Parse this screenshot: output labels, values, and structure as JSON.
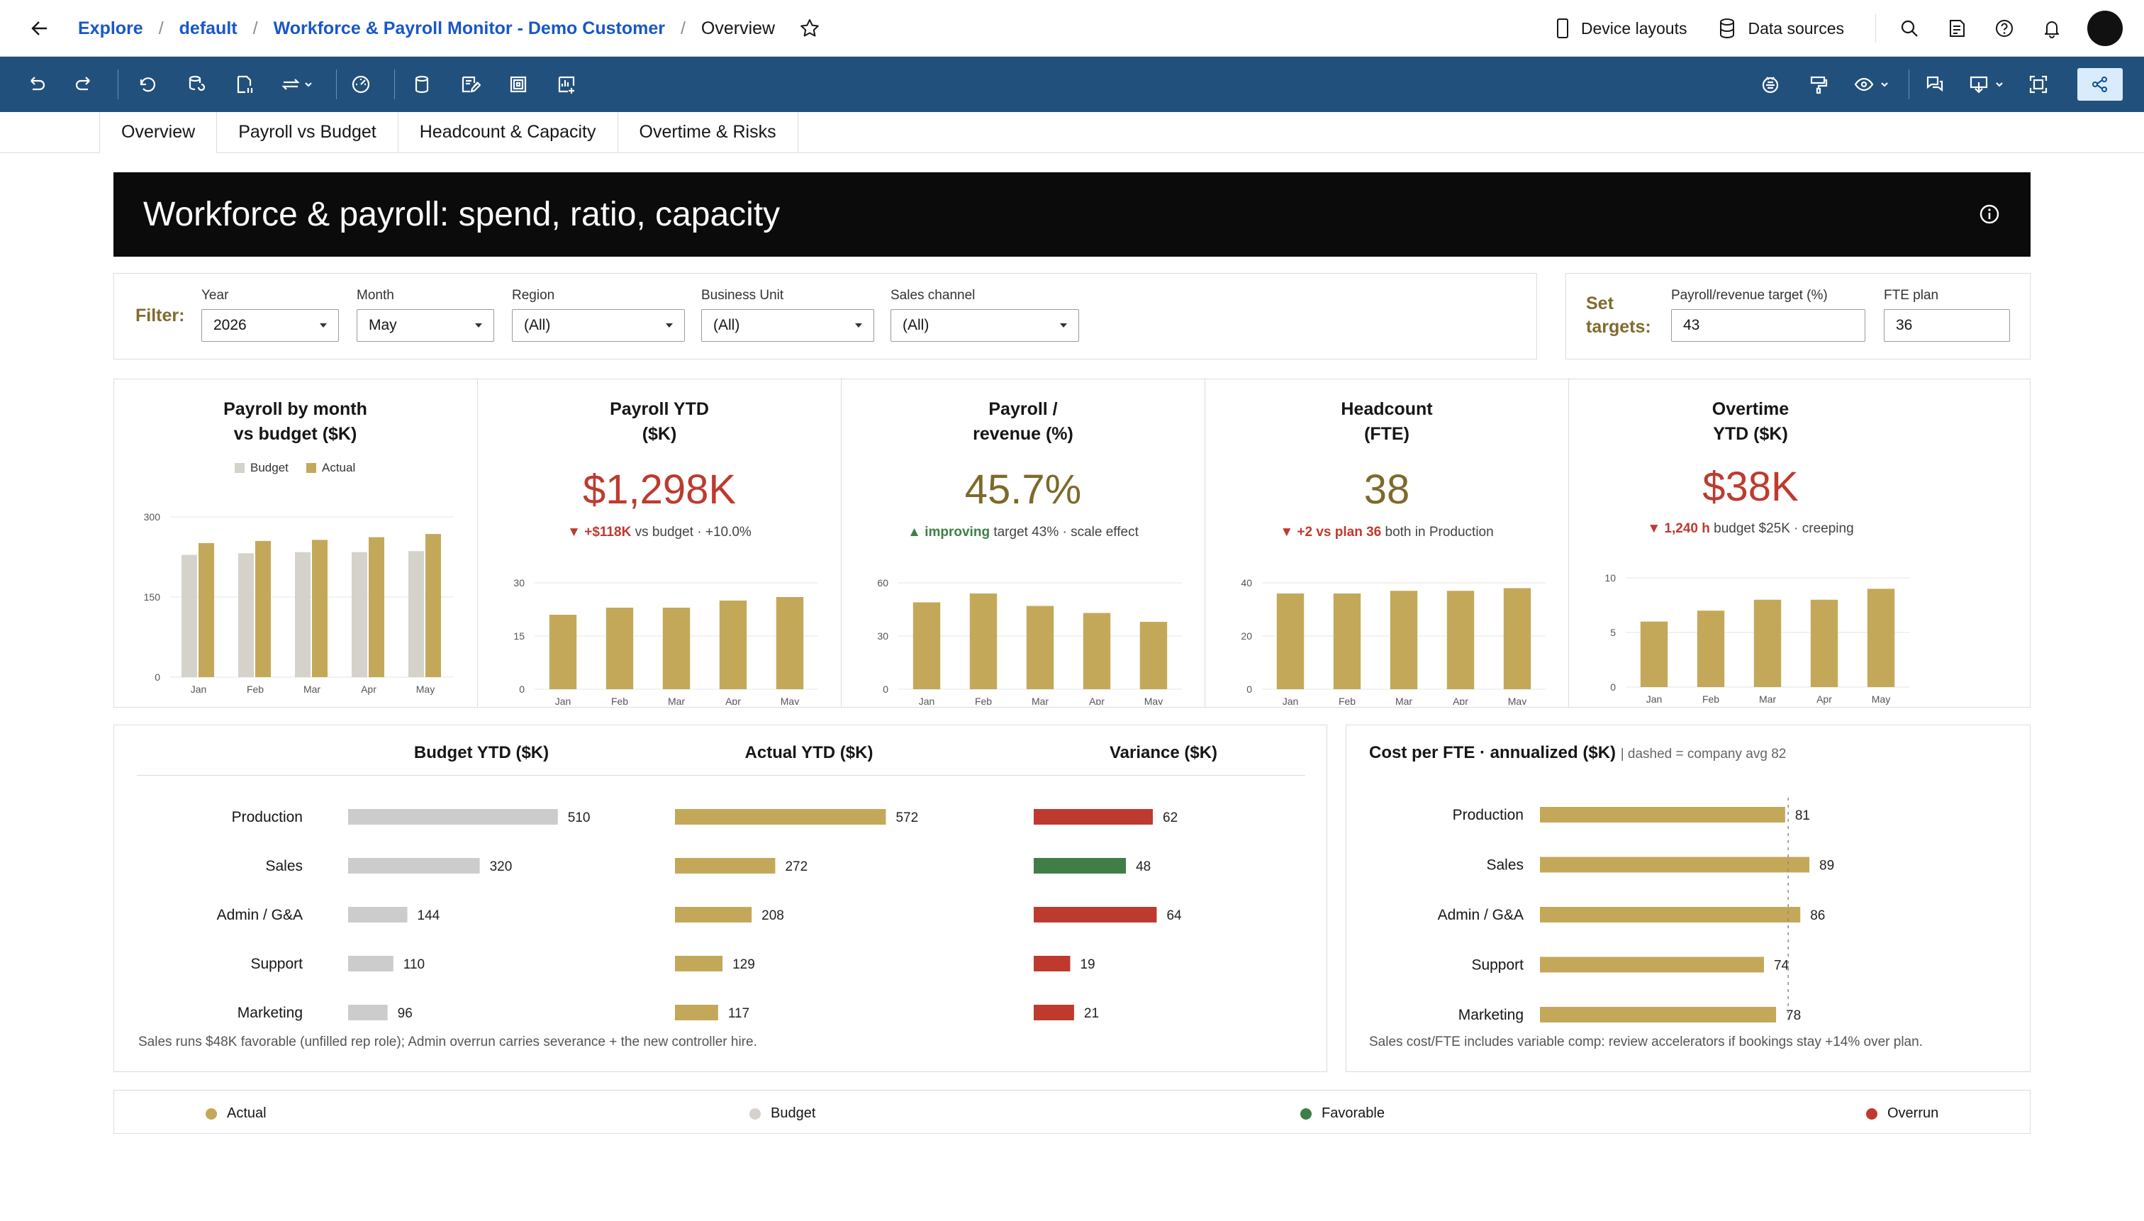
{
  "header": {
    "breadcrumbs": [
      "Explore",
      "default",
      "Workforce & Payroll Monitor - Demo Customer"
    ],
    "current": "Overview",
    "device_layouts": "Device layouts",
    "data_sources": "Data sources"
  },
  "tabs": [
    "Overview",
    "Payroll vs Budget",
    "Headcount & Capacity",
    "Overtime & Risks"
  ],
  "banner": {
    "title": "Workforce & payroll: spend, ratio, capacity"
  },
  "filters": {
    "label": "Filter:",
    "items": [
      {
        "label": "Year",
        "value": "2026"
      },
      {
        "label": "Month",
        "value": "May"
      },
      {
        "label": "Region",
        "value": "(All)"
      },
      {
        "label": "Business Unit",
        "value": "(All)"
      },
      {
        "label": "Sales channel",
        "value": "(All)"
      }
    ]
  },
  "targets": {
    "label_line1": "Set",
    "label_line2": "targets:",
    "items": [
      {
        "label": "Payroll/revenue target (%)",
        "value": "43"
      },
      {
        "label": "FTE plan",
        "value": "36"
      }
    ]
  },
  "colors": {
    "actual": "#c4a85a",
    "budget": "#d5d2cc",
    "favorable": "#3f7f47",
    "overrun": "#be3a2f",
    "table_budget": "#cccccc",
    "ratio_text": "#7d6a2b",
    "toolbar": "#22507d"
  },
  "kpis": {
    "payroll_month": {
      "title_l1": "Payroll by month",
      "title_l2": "vs budget ($K)",
      "legend": [
        "Budget",
        "Actual"
      ]
    },
    "payroll_ytd": {
      "title_l1": "Payroll YTD",
      "title_l2": "($K)",
      "value": "$1,298K",
      "sub_strong": "▼ +$118K",
      "sub_rest": " vs budget · +10.0%"
    },
    "ratio": {
      "title_l1": "Payroll /",
      "title_l2": "revenue (%)",
      "value": "45.7%",
      "sub_strong": "▲ improving",
      "sub_rest": " target 43% · scale effect"
    },
    "headcount": {
      "title_l1": "Headcount",
      "title_l2": "(FTE)",
      "value": "38",
      "sub_strong": "▼ +2 vs plan 36",
      "sub_rest": " both in Production"
    },
    "overtime": {
      "title_l1": "Overtime",
      "title_l2": "YTD ($K)",
      "value": "$38K",
      "sub_strong": "▼ 1,240 h",
      "sub_rest": " budget $25K · creeping"
    }
  },
  "chart_data": [
    {
      "type": "bar",
      "title": "Payroll by month vs budget ($K)",
      "categories": [
        "Jan",
        "Feb",
        "Mar",
        "Apr",
        "May"
      ],
      "series": [
        {
          "name": "Budget",
          "values": [
            229,
            232,
            234,
            234,
            236
          ]
        },
        {
          "name": "Actual",
          "values": [
            251,
            255,
            257,
            262,
            268
          ]
        }
      ],
      "ylim": [
        0,
        300
      ],
      "yticks": [
        0,
        150,
        300
      ]
    },
    {
      "type": "bar",
      "title": "Payroll YTD ($K)",
      "categories": [
        "Jan",
        "Feb",
        "Mar",
        "Apr",
        "May"
      ],
      "values": [
        21,
        23,
        23,
        25,
        26
      ],
      "ylim": [
        0,
        30
      ],
      "yticks": [
        0,
        15,
        30
      ]
    },
    {
      "type": "bar",
      "title": "Payroll / revenue (%)",
      "categories": [
        "Jan",
        "Feb",
        "Mar",
        "Apr",
        "May"
      ],
      "values": [
        49,
        54,
        47,
        43,
        38
      ],
      "ylim": [
        0,
        60
      ],
      "yticks": [
        0,
        30,
        60
      ]
    },
    {
      "type": "bar",
      "title": "Headcount (FTE)",
      "categories": [
        "Jan",
        "Feb",
        "Mar",
        "Apr",
        "May"
      ],
      "values": [
        36,
        36,
        37,
        37,
        38
      ],
      "ylim": [
        0,
        40
      ],
      "yticks": [
        0,
        20,
        40
      ]
    },
    {
      "type": "bar",
      "title": "Overtime YTD ($K)",
      "categories": [
        "Jan",
        "Feb",
        "Mar",
        "Apr",
        "May"
      ],
      "values": [
        6,
        7,
        8,
        8,
        9
      ],
      "ylim": [
        0,
        10
      ],
      "yticks": [
        0,
        5,
        10
      ]
    },
    {
      "type": "table",
      "columns": [
        "Budget YTD ($K)",
        "Actual YTD ($K)",
        "Variance ($K)"
      ],
      "rows": [
        "Production",
        "Sales",
        "Admin / G&A",
        "Support",
        "Marketing"
      ],
      "budget": [
        510,
        320,
        144,
        110,
        96
      ],
      "actual": [
        572,
        272,
        208,
        129,
        117
      ],
      "variance": [
        62,
        48,
        64,
        19,
        21
      ],
      "variance_status": [
        "overrun",
        "favorable",
        "overrun",
        "overrun",
        "overrun"
      ]
    },
    {
      "type": "bar",
      "title": "Cost per FTE · annualized ($K)",
      "categories": [
        "Production",
        "Sales",
        "Admin / G&A",
        "Support",
        "Marketing"
      ],
      "values": [
        81,
        89,
        86,
        74,
        78
      ],
      "reference": 82
    }
  ],
  "variance_panel": {
    "headers": [
      "Budget YTD ($K)",
      "Actual YTD ($K)",
      "Variance ($K)"
    ],
    "note": "Sales runs $48K favorable (unfilled rep role); Admin overrun carries severance + the new controller hire."
  },
  "cost_panel": {
    "title": "Cost per FTE · annualized ($K)",
    "subtitle": "| dashed = company avg 82",
    "note": "Sales cost/FTE includes variable comp: review accelerators if bookings stay +14% over plan."
  },
  "legend": [
    "Actual",
    "Budget",
    "Favorable",
    "Overrun"
  ]
}
